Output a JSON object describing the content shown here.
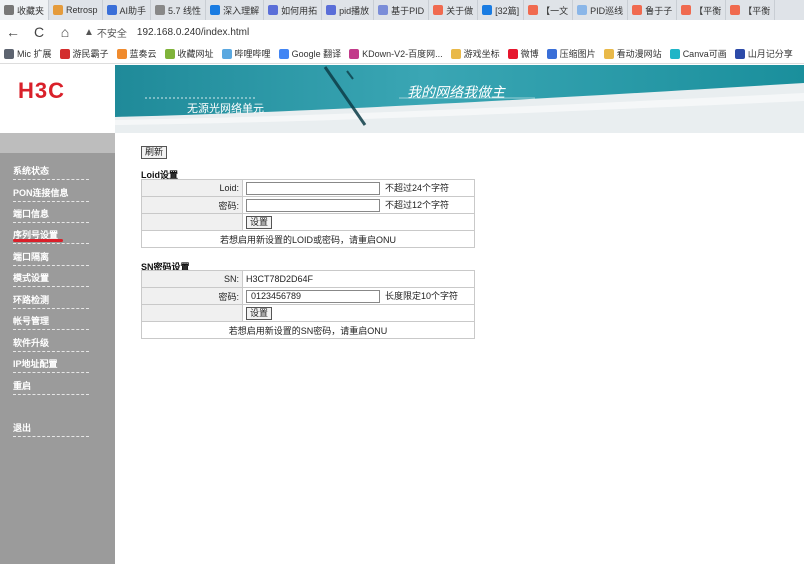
{
  "browser": {
    "tabs": [
      {
        "label": "收藏夹",
        "icon": "star-icon",
        "color": "#777777"
      },
      {
        "label": "Retrosp",
        "icon": "doc-icon",
        "color": "#e59b3b"
      },
      {
        "label": "AI助手",
        "icon": "ai-icon",
        "color": "#3a6fd8"
      },
      {
        "label": "5.7 线性",
        "icon": "refresh-icon",
        "color": "#888888"
      },
      {
        "label": "深入理解",
        "icon": "zhihu-icon",
        "color": "#1a7ce2"
      },
      {
        "label": "如何用拓",
        "icon": "paw-icon",
        "color": "#5a6ed8"
      },
      {
        "label": "pid播放",
        "icon": "paw-icon",
        "color": "#5a6ed8"
      },
      {
        "label": "基于PID",
        "icon": "doc-icon",
        "color": "#7b8dd8"
      },
      {
        "label": "关于做",
        "icon": "c-icon",
        "color": "#f06a4f"
      },
      {
        "label": "[32篇]",
        "icon": "zhihu-icon",
        "color": "#1a7ce2"
      },
      {
        "label": "【一文",
        "icon": "c-icon",
        "color": "#f06a4f"
      },
      {
        "label": "PID巡线",
        "icon": "cloud-icon",
        "color": "#8ab6e8"
      },
      {
        "label": "鲁于子",
        "icon": "c-icon",
        "color": "#f06a4f"
      },
      {
        "label": "【平衡",
        "icon": "c-icon",
        "color": "#f06a4f"
      },
      {
        "label": "【平衡",
        "icon": "c-icon",
        "color": "#f06a4f"
      }
    ],
    "nav": {
      "back": "←",
      "reload": "C",
      "home": "⌂"
    },
    "address": {
      "warning": "▲",
      "insecure": "不安全",
      "url": "192.168.0.240/index.html"
    },
    "bookmarks": [
      {
        "label": "Mic 扩展",
        "color": "#5d6470"
      },
      {
        "label": "游民霸子",
        "color": "#d32d2d"
      },
      {
        "label": "蓝奏云",
        "color": "#f08b2e"
      },
      {
        "label": "收藏网址",
        "color": "#7fb33a"
      },
      {
        "label": "哔哩哔哩",
        "color": "#5aa8e0"
      },
      {
        "label": "Google 翻译",
        "color": "#4285f4"
      },
      {
        "label": "KDown-V2-百度网...",
        "color": "#c23a8a"
      },
      {
        "label": "游戏坐标",
        "color": "#e9b949"
      },
      {
        "label": "微博",
        "color": "#e6162d"
      },
      {
        "label": "压缩图片",
        "color": "#3a6fd8"
      },
      {
        "label": "看动漫网站",
        "color": "#e9b949"
      },
      {
        "label": "Canva可画",
        "color": "#1fb5c7"
      },
      {
        "label": "山月记分享",
        "color": "#2c4aa8"
      }
    ]
  },
  "brand": {
    "logo": "H3C",
    "logo_color": "#d9202a"
  },
  "banner": {
    "subtitle": "无源光网络单元",
    "slogan": "我的网络我做主"
  },
  "sidebar": {
    "items": [
      {
        "label": "系统状态",
        "active": false
      },
      {
        "label": "PON连接信息",
        "active": false
      },
      {
        "label": "端口信息",
        "active": false
      },
      {
        "label": "序列号设置",
        "active": true
      },
      {
        "label": "端口隔离",
        "active": false
      },
      {
        "label": "模式设置",
        "active": false
      },
      {
        "label": "环路检测",
        "active": false
      },
      {
        "label": "帐号管理",
        "active": false
      },
      {
        "label": "软件升级",
        "active": false
      },
      {
        "label": "IP地址配置",
        "active": false
      },
      {
        "label": "重启",
        "active": false
      },
      {
        "label": "退出",
        "active": false
      }
    ]
  },
  "main": {
    "refresh_label": "刷新",
    "loid": {
      "title": "Loid设置",
      "loid_label": "Loid:",
      "loid_value": "",
      "loid_hint": "不超过24个字符",
      "password_label": "密码:",
      "password_value": "",
      "password_hint": "不超过12个字符",
      "set_label": "设置",
      "note": "若想启用新设置的LOID或密码，请重启ONU"
    },
    "sn": {
      "title": "SN密码设置",
      "sn_label": "SN:",
      "sn_value": "H3CT78D2D64F",
      "password_label": "密码:",
      "password_value": "0123456789",
      "password_hint": "长度限定10个字符",
      "set_label": "设置",
      "note": "若想启用新设置的SN密码，请重启ONU"
    }
  }
}
